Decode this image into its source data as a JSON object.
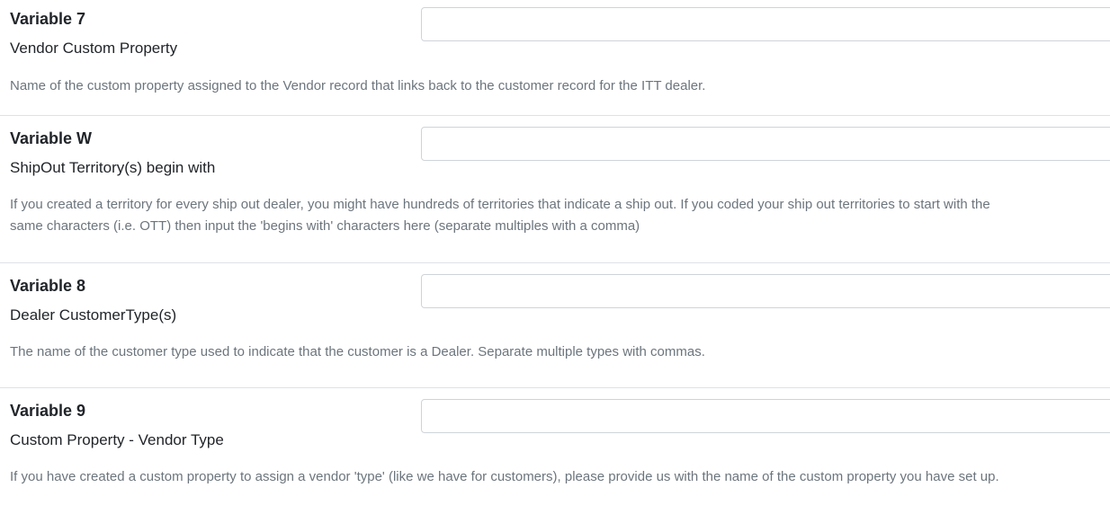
{
  "variables": [
    {
      "title": "Variable 7",
      "subtitle": "Vendor Custom Property",
      "description": "Name of the custom property assigned to the Vendor record that links back to the customer record for the ITT dealer.",
      "value": ""
    },
    {
      "title": "Variable W",
      "subtitle": "ShipOut Territory(s) begin with",
      "description": "If you created a territory for every ship out dealer, you might have hundreds of territories that indicate a ship out. If you coded your ship out territories to start with the same characters (i.e. OTT) then input the 'begins with' characters here (separate multiples with a comma)",
      "value": ""
    },
    {
      "title": "Variable 8",
      "subtitle": "Dealer CustomerType(s)",
      "description": "The name of the customer type used to indicate that the customer is a Dealer. Separate multiple types with commas.",
      "value": ""
    },
    {
      "title": "Variable 9",
      "subtitle": "Custom Property - Vendor Type",
      "description": "If you have created a custom property to assign a vendor 'type' (like we have for customers), please provide us with the name of the custom property you have set up.",
      "value": ""
    }
  ]
}
